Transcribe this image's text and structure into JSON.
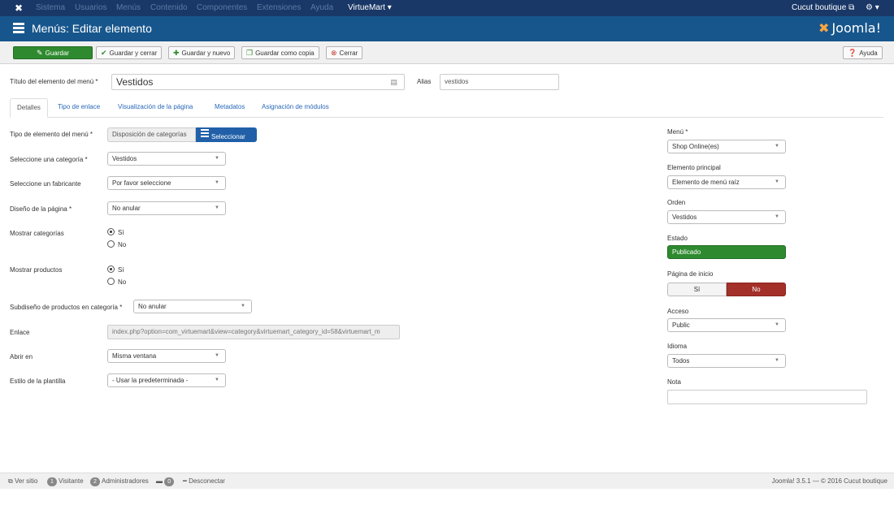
{
  "navbar": {
    "menu": [
      "Sistema",
      "Usuarios",
      "Menús",
      "Contenido",
      "Componentes",
      "Extensiones",
      "Ayuda",
      "VirtueMart ▾"
    ],
    "site_name": "Cucut boutique",
    "settings": "⚙ ▾"
  },
  "header": {
    "title": "Menús: Editar elemento",
    "brand": "Joomla!"
  },
  "toolbar": {
    "save": "Guardar",
    "save_close": "Guardar y cerrar",
    "save_new": "Guardar y nuevo",
    "save_copy": "Guardar como copia",
    "close": "Cerrar",
    "help": "Ayuda"
  },
  "form": {
    "title_label": "Título del elemento del menú *",
    "title_value": "Vestidos",
    "alias_label": "Alias",
    "alias_value": "vestidos"
  },
  "tabs": [
    "Detalles",
    "Tipo de enlace",
    "Visualización de la página",
    "Metadatos",
    "Asignación de módulos"
  ],
  "details": {
    "item_type_label": "Tipo de elemento del menú *",
    "item_type_value": "Disposición de categorías",
    "select_button": "Seleccionar",
    "category_label": "Seleccione una categoría *",
    "category_value": "Vestidos",
    "manufacturer_label": "Seleccione un fabricante",
    "manufacturer_value": "Por favor seleccione",
    "page_layout_label": "Diseño de la página *",
    "page_layout_value": "No anular",
    "show_categories_label": "Mostrar categorías",
    "show_products_label": "Mostrar productos",
    "yes": "Sí",
    "no": "No",
    "product_sublayout_label": "Subdiseño de productos en categoría *",
    "product_sublayout_value": "No anular",
    "link_label": "Enlace",
    "link_value": "index.php?option=com_virtuemart&view=category&virtuemart_category_id=58&virtuemart_m",
    "open_in_label": "Abrir en",
    "open_in_value": "Misma ventana",
    "template_style_label": "Estilo de la plantilla",
    "template_style_value": "- Usar la predeterminada -"
  },
  "sidebar": {
    "menu_label": "Menú *",
    "menu_value": "Shop Online(es)",
    "parent_label": "Elemento principal",
    "parent_value": "Elemento de menú raíz",
    "order_label": "Orden",
    "order_value": "Vestidos",
    "status_label": "Estado",
    "status_value": "Publicado",
    "home_label": "Página de inicio",
    "home_yes": "Sí",
    "home_no": "No",
    "access_label": "Acceso",
    "access_value": "Public",
    "language_label": "Idioma",
    "language_value": "Todos",
    "note_label": "Nota",
    "note_value": ""
  },
  "footer": {
    "view_site": "Ver sitio",
    "visitors_count": "1",
    "visitors_label": "Visitante",
    "admins_count": "2",
    "admins_label": "Administradores",
    "messages_count": "0",
    "logout": "Desconectar",
    "version": "Joomla! 3.5.1 — © 2016 Cucut boutique"
  },
  "colors": {
    "navbar": "#1a3867",
    "titlebar": "#17568c",
    "save_green": "#2f8a2f",
    "home_no_red": "#a4302a",
    "select_blue": "#2160a8"
  }
}
